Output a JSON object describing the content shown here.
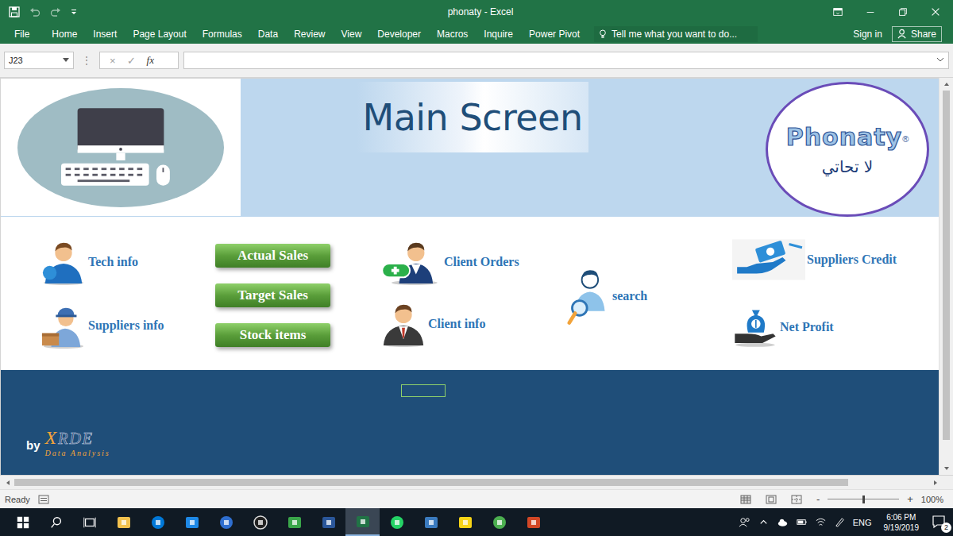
{
  "window": {
    "title": "phonaty - Excel"
  },
  "account": {
    "sign_in": "Sign in",
    "share": "Share"
  },
  "ribbon_tabs": [
    {
      "label": "File",
      "selected": false
    },
    {
      "label": "Home",
      "selected": false
    },
    {
      "label": "Insert",
      "selected": false
    },
    {
      "label": "Page Layout",
      "selected": false
    },
    {
      "label": "Formulas",
      "selected": false
    },
    {
      "label": "Data",
      "selected": false
    },
    {
      "label": "Review",
      "selected": false
    },
    {
      "label": "View",
      "selected": false
    },
    {
      "label": "Developer",
      "selected": false
    },
    {
      "label": "Macros",
      "selected": false
    },
    {
      "label": "Inquire",
      "selected": false
    },
    {
      "label": "Power Pivot",
      "selected": false
    }
  ],
  "tell_me": {
    "placeholder": "Tell me what you want to do..."
  },
  "formula_bar": {
    "name_box": "J23",
    "cancel": "×",
    "enter": "✓",
    "fx": "fx",
    "value": ""
  },
  "sheet": {
    "title": "Main Screen",
    "logo": {
      "name": "Phonaty",
      "mark": "®",
      "tagline": "لا تحاتي"
    },
    "links": {
      "tech_info": "Tech info",
      "suppliers_info": "Suppliers info",
      "client_orders": "Client Orders",
      "client_info": "Client info",
      "search": "search",
      "suppliers_credit": "Suppliers Credit",
      "net_profit": "Net Profit"
    },
    "buttons": [
      "Actual Sales",
      "Target Sales",
      "Stock items"
    ],
    "footer": {
      "by": "by",
      "brand_x": "X",
      "brand": "RDE",
      "sub": "Data Analysis"
    }
  },
  "status_bar": {
    "status": "Ready",
    "zoom_out": "-",
    "zoom_in": "+",
    "zoom": "100%",
    "zoom_level": 0.5
  },
  "taskbar": {
    "apps": [
      {
        "active": false
      },
      {
        "active": false
      },
      {
        "active": false
      },
      {
        "active": false
      },
      {
        "active": false
      },
      {
        "active": false
      },
      {
        "active": false
      },
      {
        "active": true
      },
      {
        "active": false
      },
      {
        "active": false
      },
      {
        "active": false
      },
      {
        "active": false
      },
      {
        "active": false
      }
    ],
    "language": "ENG",
    "time": "6:06 PM",
    "date": "9/19/2019",
    "notifications": "2"
  }
}
